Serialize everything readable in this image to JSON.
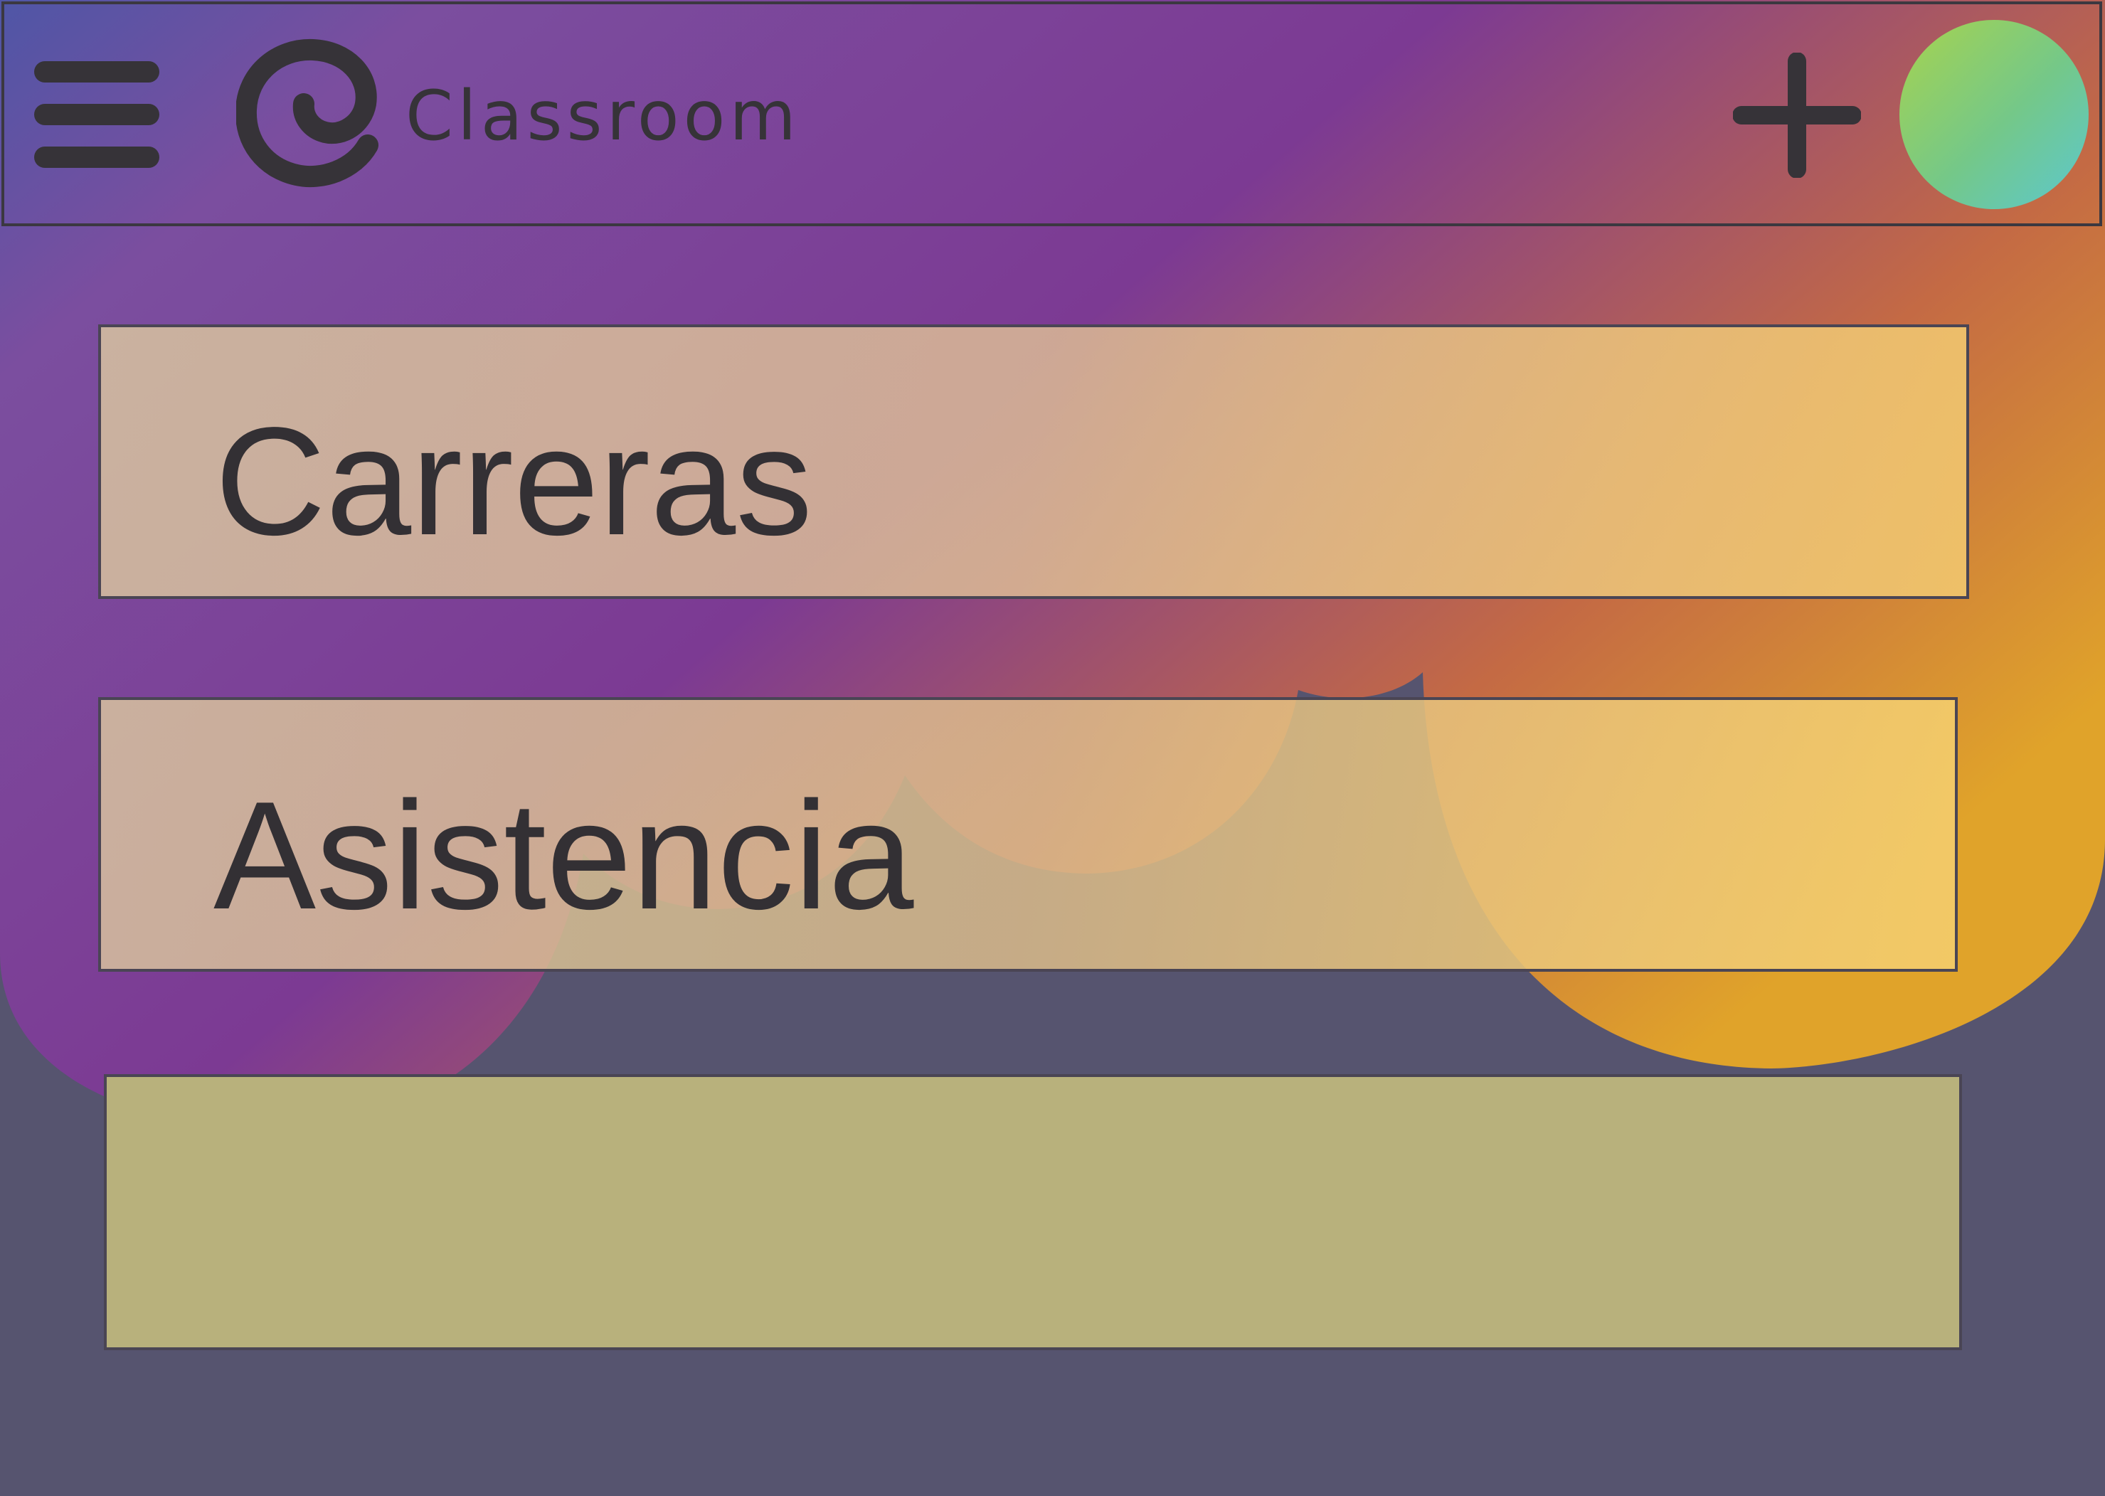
{
  "app": {
    "name": "Classroom"
  },
  "header": {
    "menu_icon": "hamburger-menu-icon",
    "logo_icon": "classroom-spiral-logo-icon",
    "add_icon": "plus-icon",
    "avatar_icon": "user-avatar"
  },
  "cards": [
    {
      "label": "Carreras"
    },
    {
      "label": "Asistencia"
    },
    {
      "label": ""
    }
  ],
  "colors": {
    "background": "#56546f",
    "gradient_start": "#4f56a6",
    "gradient_mid": "#7c3a93",
    "gradient_end": "#e0a32a",
    "card_fill": "#b8b17c",
    "text": "#333034"
  }
}
